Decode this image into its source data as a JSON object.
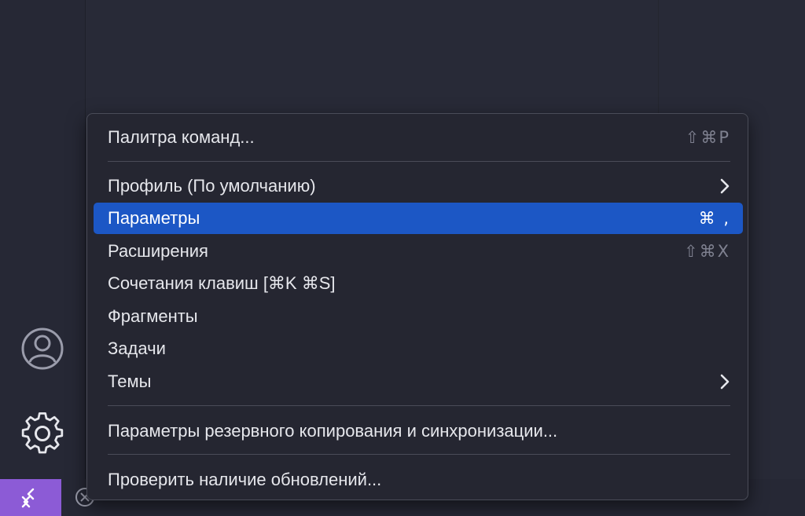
{
  "menu": {
    "items": [
      {
        "label": "Палитра команд...",
        "shortcut": "⇧⌘P"
      },
      {
        "label": "Профиль (По умолчанию)",
        "shortcut": ""
      },
      {
        "label": "Параметры",
        "shortcut": "⌘ ,"
      },
      {
        "label": "Расширения",
        "shortcut": "⇧⌘X"
      },
      {
        "label": "Сочетания клавиш [⌘K ⌘S]",
        "shortcut": ""
      },
      {
        "label": "Фрагменты",
        "shortcut": ""
      },
      {
        "label": "Задачи",
        "shortcut": ""
      },
      {
        "label": "Темы",
        "shortcut": ""
      },
      {
        "label": "Параметры резервного копирования и синхронизации...",
        "shortcut": ""
      },
      {
        "label": "Проверить наличие обновлений...",
        "shortcut": ""
      }
    ],
    "selected_label": "Параметры"
  },
  "activity_bar": {
    "icons": [
      "account-icon",
      "gear-icon"
    ]
  },
  "status_bar": {
    "remote_icon": "remote-icon",
    "problems_icon": "error-icon"
  },
  "colors": {
    "accent_selected": "#1c57c5",
    "remote": "#8c5bd6",
    "menu_bg": "#252631"
  }
}
